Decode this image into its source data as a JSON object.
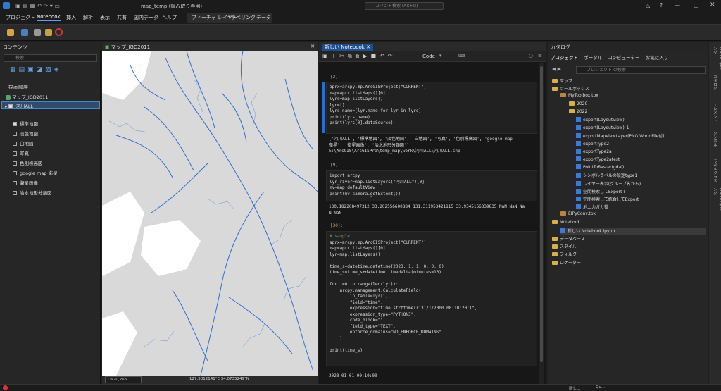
{
  "window": {
    "title": "map_temp (読み取り専用)",
    "search_placeholder": "コマンド検索 (Alt+Q)"
  },
  "menu": {
    "items": [
      "プロジェクト",
      "Notebook",
      "挿入",
      "解析",
      "表示",
      "共有",
      "国内データ",
      "ヘルプ"
    ],
    "group_items": [
      "フィーチャ レイヤー",
      "ラベリング",
      "データ"
    ],
    "active": "Notebook"
  },
  "contents": {
    "title": "コンテンツ",
    "search_placeholder": "検索",
    "drawing_order": "描画順序",
    "map_name": "マップ_IGD2011",
    "layers": [
      "河川ALL",
      "標準地図",
      "淡色地図",
      "白地図",
      "写真",
      "色別標高図",
      "google map 衛星",
      "衛星画像",
      "治水地形分類図"
    ]
  },
  "mapview": {
    "tab": "マップ_IGD2011",
    "scale": "1:920,266",
    "coords": "127.5012141°E 34.0735249°N",
    "colors": {
      "land": "#d9d9d9",
      "sea": "#ffffff",
      "river": "#2f6fd6"
    }
  },
  "notebook": {
    "tab": "新しい Notebook",
    "cell_type": "Code",
    "cells": [
      {
        "prompt": "[2]:",
        "code": [
          "aprx=arcpy.mp.ArcGISProject(\"CURRENT\")",
          "map=aprx.listMaps()[0]",
          "lyrs=map.listLayers()",
          "lyr=[]",
          "lyrs_name=[lyr.name for lyr in lyrs]",
          "print(lyrs_name)",
          "print(lyrs[0].dataSource)"
        ],
        "output": [
          "['河川ALL', '標準地図', '淡色地図', '白地図', '写真', '色別標高図', 'google map",
          "衛星', '衛星画像', '治水地形分類図']",
          "E:\\ArcGIS\\ArcGISPro\\temp_map\\work\\河川ALL\\河川ALL.shp"
        ]
      },
      {
        "prompt": "[9]:",
        "code": [
          "import arcpy",
          "lyr_river=map.listLayers(\"河川ALL\")[0]",
          "mv=map.defaultView",
          "print(mv.camera.getExtent())"
        ],
        "output": [
          "130.182208497312 33.202556600884 131.311953421115 33.9345166339835 NaN NaN Na",
          "N NaN"
        ]
      },
      {
        "prompt": "[30]:",
        "code": [
          "# sample",
          "aprx=arcpy.mp.ArcGISProject(\"CURRENT\")",
          "map=aprx.listMaps()[0]",
          "lyr=map.listLayers()",
          "",
          "time_s=datetime.datetime(2023, 1, 1, 0, 0, 0)",
          "time_s=time_s+datetime.timedelta(minutes=10)",
          "",
          "for i=0 to range(len(lyr)):",
          "    arcpy.management.CalculateField(",
          "        in_table=lyr[i],",
          "        field=\"time\",",
          "        expression=\"time.strftime(r'31/1/2000 00:10:20')\",",
          "        expression_type=\"PYTHON3\",",
          "        code_block=\"\",",
          "        field_type=\"TEXT\",",
          "        enforce_domains=\"NO_ENFORCE_DOMAINS\"",
          "    )",
          "",
          "print(time_s)"
        ],
        "output": [
          "2023-01-01 00:10:00"
        ]
      }
    ]
  },
  "catalog": {
    "title": "カタログ",
    "tabs": [
      "プロジェクト",
      "ポータル",
      "コンピューター",
      "お気に入り"
    ],
    "search_placeholder": "プロジェクト の検索",
    "items": [
      {
        "label": "マップ",
        "level": 1,
        "type": "folder"
      },
      {
        "label": "ツールボックス",
        "level": 1,
        "type": "folder"
      },
      {
        "label": "MyToolbox.tbx",
        "level": 2,
        "type": "tbx"
      },
      {
        "label": "2020",
        "level": 3,
        "type": "folder"
      },
      {
        "label": "2022",
        "level": 3,
        "type": "folder"
      },
      {
        "label": "export(LayoutView)",
        "level": 4,
        "type": "py"
      },
      {
        "label": "export(LayoutView)_1",
        "level": 4,
        "type": "py"
      },
      {
        "label": "exportMapViewLayer(PNG WorldFile付)",
        "level": 4,
        "type": "py"
      },
      {
        "label": "exportType2",
        "level": 4,
        "type": "py"
      },
      {
        "label": "exportType2a",
        "level": 4,
        "type": "py"
      },
      {
        "label": "exportType2atest",
        "level": 4,
        "type": "py"
      },
      {
        "label": "PointToRaster(gdal)",
        "level": 4,
        "type": "py"
      },
      {
        "label": "シンボルラベルの設定type1",
        "level": 4,
        "type": "py"
      },
      {
        "label": "レイヤー表示(グループ名から)",
        "level": 4,
        "type": "py"
      },
      {
        "label": "空間検索してExport I",
        "level": 4,
        "type": "py"
      },
      {
        "label": "空間検索して統合してExport",
        "level": 4,
        "type": "py"
      },
      {
        "label": "地上力ガカ掛",
        "level": 4,
        "type": "py"
      },
      {
        "label": "EIPyConv.tbx",
        "level": 2,
        "type": "tbx"
      },
      {
        "label": "Notebook",
        "level": 1,
        "type": "folder"
      },
      {
        "label": "新しい Notebook.ipynb",
        "level": 2,
        "type": "nb"
      },
      {
        "label": "データベース",
        "level": 1,
        "type": "folder"
      },
      {
        "label": "スタイル",
        "level": 1,
        "type": "folder"
      },
      {
        "label": "フォルダー",
        "level": 1,
        "type": "folder"
      },
      {
        "label": "ロケーター",
        "level": 1,
        "type": "folder"
      }
    ]
  },
  "sidestrip": {
    "tabs": [
      "ジオプロセシング",
      "カタログ",
      "エレメント",
      "シンボル",
      "ラベルクラス",
      "ジオプロセシング"
    ]
  },
  "taskbar": {
    "items": [
      "新し...",
      "Qu..."
    ]
  }
}
